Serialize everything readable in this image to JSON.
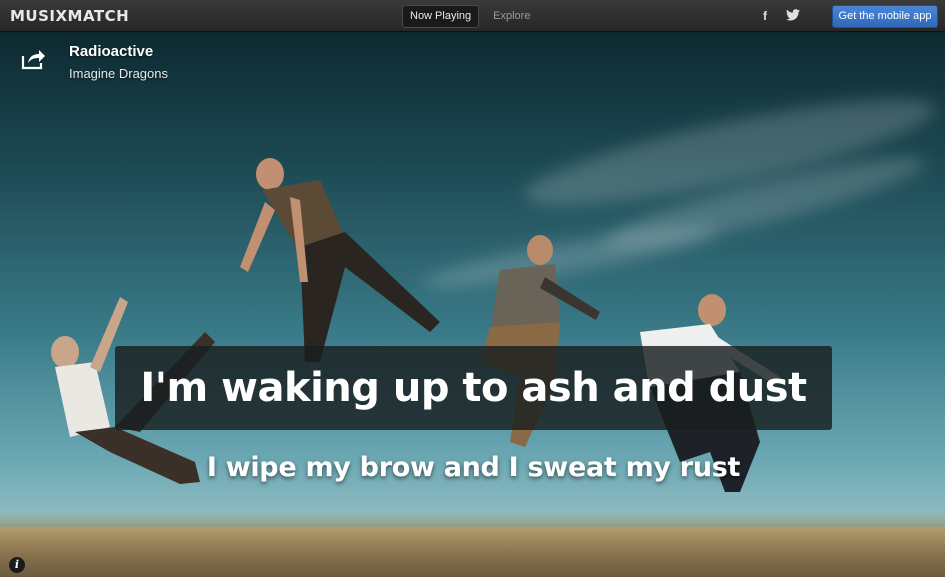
{
  "app": {
    "logo": "MUSIXMATCH"
  },
  "nav": {
    "tabs": [
      {
        "label": "Now Playing",
        "active": true
      },
      {
        "label": "Explore",
        "active": false
      }
    ]
  },
  "social": {
    "facebook_glyph": "f",
    "twitter_icon": "twitter-bird-icon"
  },
  "cta": {
    "mobile_label": "Get the mobile app"
  },
  "track": {
    "title": "Radioactive",
    "artist": "Imagine Dragons",
    "share_icon": "share-icon"
  },
  "lyrics": {
    "current": "I'm waking up to ash and dust",
    "next": "I wipe my brow and I sweat my rust"
  },
  "footer": {
    "info_glyph": "i"
  },
  "colors": {
    "accent": "#3a78cc",
    "topbar": "#2b2b2b"
  }
}
